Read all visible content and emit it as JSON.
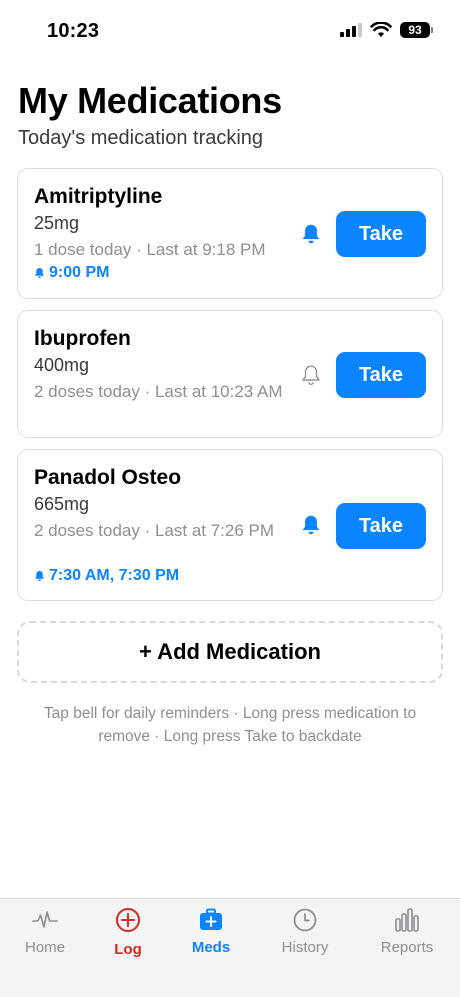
{
  "status_bar": {
    "time": "10:23",
    "battery": "93"
  },
  "header": {
    "title": "My Medications",
    "subtitle": "Today's medication tracking"
  },
  "medications": [
    {
      "name": "Amitriptyline",
      "dose": "25mg",
      "info": "1 dose today · Last at 9:18 PM",
      "reminder": "9:00 PM",
      "bell": "bell-filled-icon",
      "action": "Take"
    },
    {
      "name": "Ibuprofen",
      "dose": "400mg",
      "info": "2 doses today · Last at 10:23 AM",
      "reminder": "",
      "bell": "bell-outline-icon",
      "action": "Take"
    },
    {
      "name": "Panadol Osteo",
      "dose": "665mg",
      "info": "2 doses today · Last at 7:26 PM",
      "reminder": "7:30 AM, 7:30 PM",
      "bell": "bell-filled-icon",
      "action": "Take"
    }
  ],
  "add_button": {
    "label": "+ Add Medication"
  },
  "hint": "Tap bell for daily reminders · Long press medication to remove · Long press Take to backdate",
  "tabs": [
    {
      "label": "Home",
      "icon": "heartbeat-icon",
      "state": "normal"
    },
    {
      "label": "Log",
      "icon": "plus-circle-icon",
      "state": "log"
    },
    {
      "label": "Meds",
      "icon": "medkit-icon",
      "state": "active"
    },
    {
      "label": "History",
      "icon": "clock-icon",
      "state": "normal"
    },
    {
      "label": "Reports",
      "icon": "bar-chart-icon",
      "state": "normal"
    }
  ],
  "colors": {
    "accent": "#0a84ff",
    "log": "#d9251d",
    "muted": "#8e8e93"
  }
}
